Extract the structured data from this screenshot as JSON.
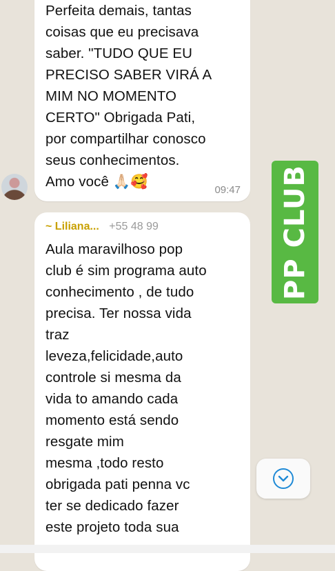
{
  "messages": [
    {
      "text": "Perfeita demais, tantas\ncoisas que eu precisava\nsaber. \"TUDO QUE EU\nPRECISO SABER VIRÁ A\nMIM NO MOMENTO\nCERTO\" Obrigada Pati,\npor compartilhar conosco\nseus conhecimentos.\nAmo você 🙏🏻🥰",
      "time": "09:47"
    },
    {
      "sender": "~ Liliana...",
      "phone": "+55 48 99",
      "text": "Aula maravilhoso pop\nclub é sim programa auto\nconhecimento , de tudo\nprecisa. Ter nossa vida\ntraz\nleveza,felicidade,auto\ncontrole si mesma da\nvida to amando cada\nmomento  está sendo\nresgate mim\nmesma ,todo resto\nobrigada pati penna vc\nter  se dedicado fazer\neste projeto toda sua"
    }
  ],
  "overlay_tag": "PP CLUB",
  "icons": {
    "avatar": "avatar",
    "scroll": "chevron-down-icon"
  },
  "colors": {
    "tag_green": "#58b943",
    "sender_name": "#c8a000",
    "scroll_icon": "#1f8ad6"
  }
}
